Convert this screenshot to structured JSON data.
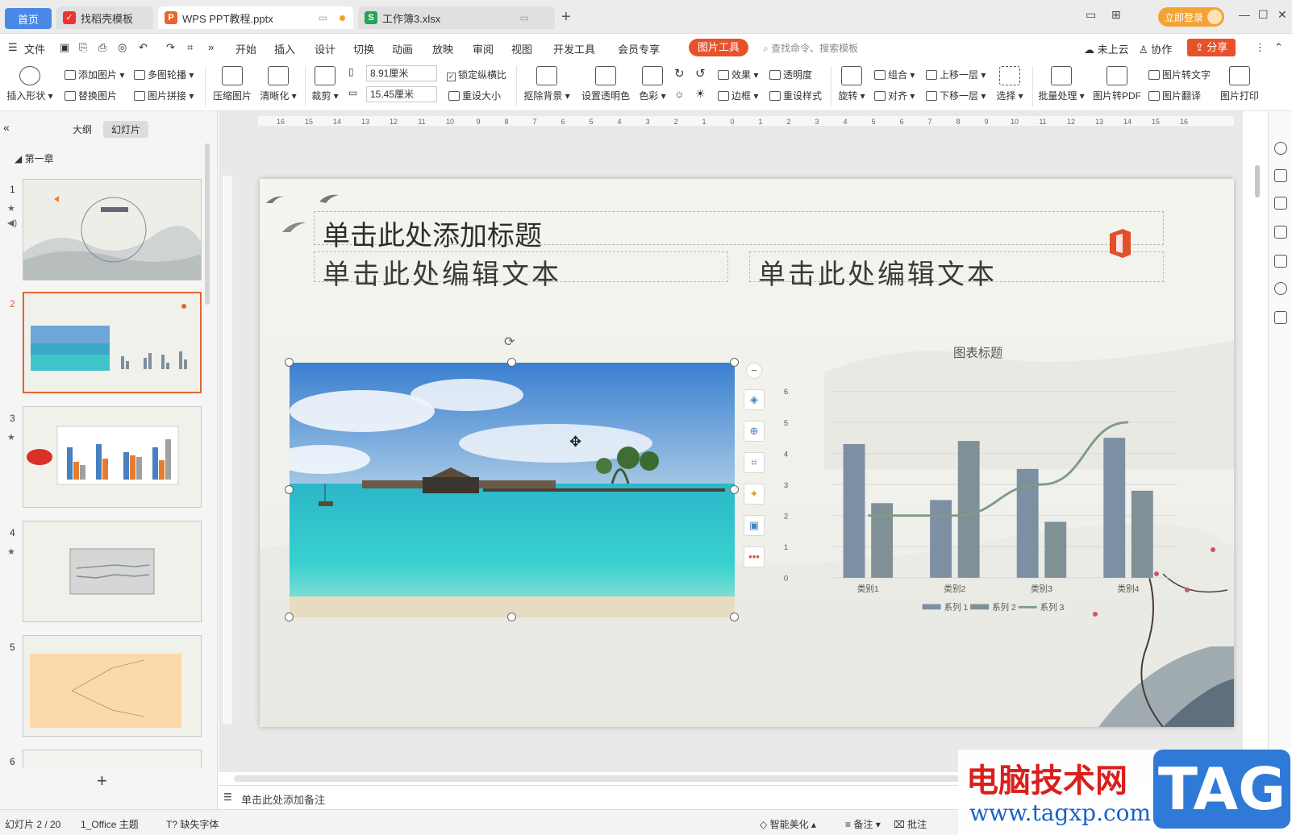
{
  "titlebar": {
    "tabs": [
      {
        "label": "首页"
      },
      {
        "label": "找稻壳模板"
      },
      {
        "label": "WPS PPT教程.pptx"
      },
      {
        "label": "工作簿3.xlsx"
      }
    ],
    "login_label": "立即登录"
  },
  "menu": {
    "file": "文件",
    "items": [
      "开始",
      "插入",
      "设计",
      "切换",
      "动画",
      "放映",
      "审阅",
      "视图",
      "开发工具",
      "会员专享"
    ],
    "active": "图片工具",
    "search_placeholder": "查找命令、搜索模板",
    "cloud": "未上云",
    "collab": "协作",
    "share": "分享"
  },
  "ribbon": {
    "insert_shape": "插入形状",
    "add_image": "添加图片",
    "multi_carousel": "多图轮播",
    "replace_image": "替换图片",
    "image_collage": "图片拼接",
    "compress": "压缩图片",
    "sharpen": "清晰化",
    "crop": "裁剪",
    "height_value": "8.91厘米",
    "width_value": "15.45厘米",
    "lock_ratio": "锁定纵横比",
    "reset_size": "重设大小",
    "remove_bg": "抠除背景",
    "set_transparent": "设置透明色",
    "color": "色彩",
    "effect": "效果",
    "transparency": "透明度",
    "border": "边框",
    "reset_style": "重设样式",
    "rotate": "旋转",
    "group": "组合",
    "align": "对齐",
    "bring_forward": "上移一层",
    "send_backward": "下移一层",
    "select": "选择",
    "batch": "批量处理",
    "to_pdf": "图片转PDF",
    "to_text": "图片转文字",
    "translate": "图片翻译",
    "print": "图片打印"
  },
  "leftpanel": {
    "tab_outline": "大纲",
    "tab_slides": "幻灯片",
    "section": "第一章",
    "slides": [
      "1",
      "2",
      "3",
      "4",
      "5",
      "6"
    ]
  },
  "slide": {
    "title_placeholder": "单击此处添加标题",
    "text_left": "单击此处编辑文本",
    "text_right": "单击此处编辑文本"
  },
  "chart_data": {
    "type": "bar",
    "title": "图表标题",
    "categories": [
      "类别1",
      "类别2",
      "类别3",
      "类别4"
    ],
    "series": [
      {
        "name": "系列 1",
        "values": [
          4.3,
          2.5,
          3.5,
          4.5
        ],
        "kind": "bar",
        "color": "#7d8fa3"
      },
      {
        "name": "系列 2",
        "values": [
          2.4,
          4.4,
          1.8,
          2.8
        ],
        "kind": "bar",
        "color": "#7f9096"
      },
      {
        "name": "系列 3",
        "values": [
          2,
          2,
          3,
          5
        ],
        "kind": "line",
        "color": "#7f9b87"
      }
    ],
    "ylim": [
      0,
      6
    ],
    "yticks": [
      "0",
      "1",
      "2",
      "3",
      "4",
      "5",
      "6"
    ],
    "grid": true,
    "legend_position": "bottom"
  },
  "notes": {
    "placeholder": "单击此处添加备注"
  },
  "statusbar": {
    "slide_info": "幻灯片 2 / 20",
    "theme": "1_Office 主题",
    "missing_font": "缺失字体",
    "smart_beautify": "智能美化",
    "notes": "备注",
    "comments": "批注"
  },
  "watermark": {
    "site_name": "电脑技术网",
    "url": "www.tagxp.com",
    "tag": "TAG"
  }
}
